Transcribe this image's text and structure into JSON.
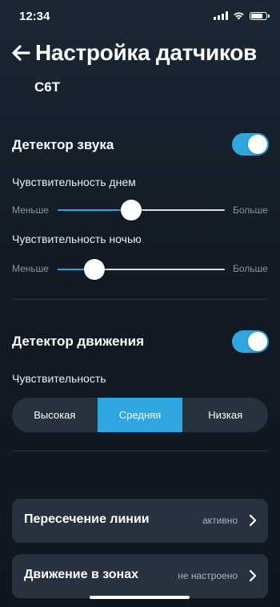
{
  "status_bar": {
    "time": "12:34"
  },
  "header": {
    "title": "Настройка датчиков",
    "device": "C6T"
  },
  "sound_detector": {
    "title": "Детектор звука",
    "enabled": true,
    "day": {
      "label": "Чувствительность днем",
      "min_label": "Меньше",
      "max_label": "Больше",
      "value": 0.44
    },
    "night": {
      "label": "Чувствительность ночью",
      "min_label": "Меньше",
      "max_label": "Больше",
      "value": 0.22
    }
  },
  "motion_detector": {
    "title": "Детектор движения",
    "enabled": true,
    "sensitivity_label": "Чувствительность",
    "options": [
      "Высокая",
      "Средняя",
      "Низкая"
    ],
    "selected": "Средняя"
  },
  "rows": [
    {
      "title": "Пересечение линии",
      "status": "активно"
    },
    {
      "title": "Движение в зонах",
      "status": "не настроено"
    }
  ],
  "colors": {
    "accent": "#2fa6de",
    "background": "#141d27",
    "card": "#28323e"
  }
}
